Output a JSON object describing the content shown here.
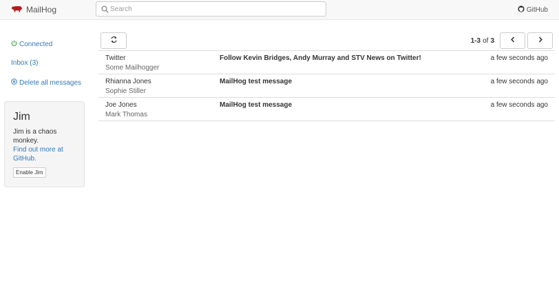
{
  "navbar": {
    "brand": "MailHog",
    "search_placeholder": "Search",
    "github": "GitHub",
    "brand_color": "#b71c1c"
  },
  "sidebar": {
    "connected": "Connected",
    "inbox": "Inbox (3)",
    "delete_all": "Delete all messages",
    "status_color": "#3c9a3c"
  },
  "jim": {
    "title": "Jim",
    "line1": "Jim is a chaos monkey.",
    "link": "Find out more at GitHub.",
    "button": "Enable Jim"
  },
  "toolbar": {
    "range": "1-3",
    "of": "of",
    "total": "3"
  },
  "messages": [
    {
      "from": "Twitter",
      "to": "Some Mailhogger",
      "subject": "Follow Kevin Bridges, Andy Murray and STV News on Twitter!",
      "time": "a few seconds ago"
    },
    {
      "from": "Rhianna Jones",
      "to": "Sophie Stiller",
      "subject": "MailHog test message",
      "time": "a few seconds ago"
    },
    {
      "from": "Joe Jones",
      "to": "Mark Thomas",
      "subject": "MailHog test message",
      "time": "a few seconds ago"
    }
  ]
}
